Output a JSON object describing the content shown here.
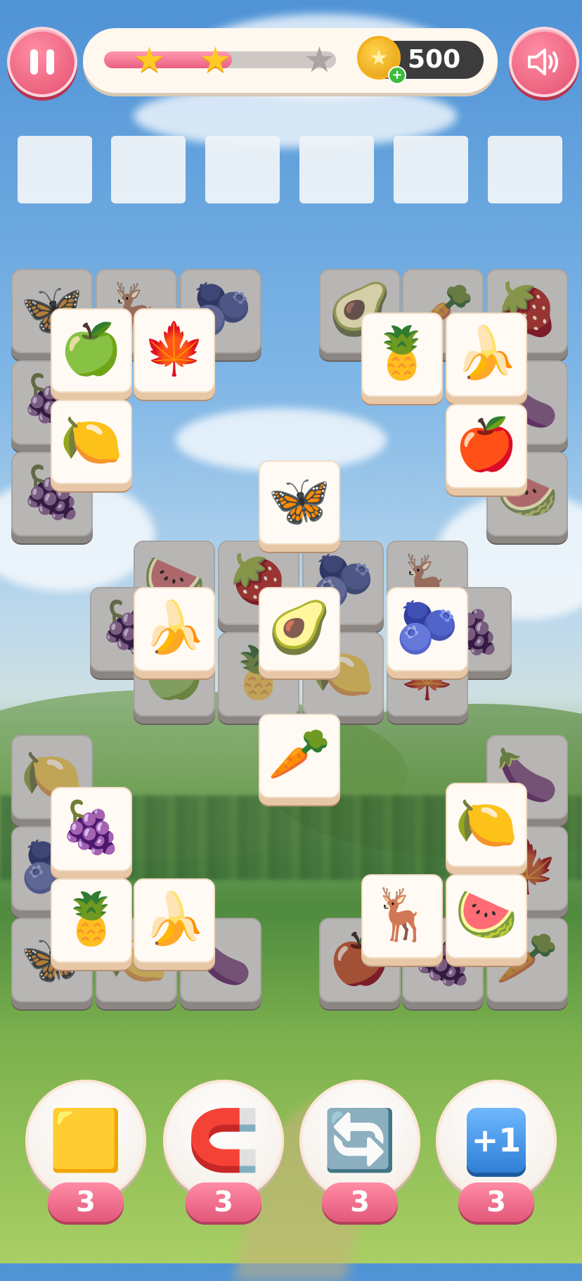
{
  "topbar": {
    "pause_icon": "pause-icon",
    "sound_icon": "speaker-icon",
    "progress_fraction": 0.55,
    "stars_earned": 2,
    "stars_total": 3,
    "coins": "500",
    "coin_icon": "coin-icon",
    "coin_add_icon": "plus-icon"
  },
  "tray": {
    "slot_count": 6,
    "slots_filled": 0
  },
  "tiles": {
    "back": [
      {
        "id": "b1",
        "icon": "🦋",
        "glyph": "🦋"
      },
      {
        "id": "b2",
        "icon": "🦌",
        "glyph": "🦌"
      },
      {
        "id": "b3",
        "icon": "🫐",
        "glyph": "🫐"
      },
      {
        "id": "b4",
        "icon": "🍇",
        "glyph": "🍇"
      },
      {
        "id": "b5",
        "icon": "🍇",
        "glyph": "🍇"
      },
      {
        "id": "b6",
        "icon": "🥑",
        "glyph": "🥑"
      },
      {
        "id": "b7",
        "icon": "🥕",
        "glyph": "🥕"
      },
      {
        "id": "b8",
        "icon": "🍓",
        "glyph": "🍓"
      },
      {
        "id": "b9",
        "icon": "🍆",
        "glyph": "🍆"
      },
      {
        "id": "b10",
        "icon": "🍉",
        "glyph": "🍉"
      },
      {
        "id": "b11",
        "icon": "🍉",
        "glyph": "🍉"
      },
      {
        "id": "b12",
        "icon": "🍓",
        "glyph": "🍓"
      },
      {
        "id": "b13",
        "icon": "🫐",
        "glyph": "🫐"
      },
      {
        "id": "b14",
        "icon": "🦌",
        "glyph": "🦌"
      },
      {
        "id": "b15",
        "icon": "🍇",
        "glyph": "🍇"
      },
      {
        "id": "b16",
        "icon": "🍇",
        "glyph": "🍇"
      },
      {
        "id": "b17",
        "icon": "🍏",
        "glyph": "🍏"
      },
      {
        "id": "b18",
        "icon": "🍍",
        "glyph": "🍍"
      },
      {
        "id": "b19",
        "icon": "🍋",
        "glyph": "🍋"
      },
      {
        "id": "b20",
        "icon": "🍁",
        "glyph": "🍁"
      },
      {
        "id": "b21",
        "icon": "🍋",
        "glyph": "🍋"
      },
      {
        "id": "b22",
        "icon": "🫐",
        "glyph": "🫐"
      },
      {
        "id": "b23",
        "icon": "🦋",
        "glyph": "🦋"
      },
      {
        "id": "b24",
        "icon": "🍋",
        "glyph": "🍋"
      },
      {
        "id": "b25",
        "icon": "🍆",
        "glyph": "🍆"
      },
      {
        "id": "b26",
        "icon": "🍆",
        "glyph": "🍆"
      },
      {
        "id": "b27",
        "icon": "🍁",
        "glyph": "🍁"
      },
      {
        "id": "b28",
        "icon": "🍎",
        "glyph": "🍎"
      },
      {
        "id": "b29",
        "icon": "🍇",
        "glyph": "🍇"
      },
      {
        "id": "b30",
        "icon": "🥕",
        "glyph": "🥕"
      }
    ],
    "front": [
      {
        "id": "f1",
        "icon": "🍏",
        "glyph": "🍏"
      },
      {
        "id": "f2",
        "icon": "🍁",
        "glyph": "🍁"
      },
      {
        "id": "f3",
        "icon": "🍋",
        "glyph": "🍋"
      },
      {
        "id": "f4",
        "icon": "🍍",
        "glyph": "🍍"
      },
      {
        "id": "f5",
        "icon": "🍌",
        "glyph": "🍌"
      },
      {
        "id": "f6",
        "icon": "🍎",
        "glyph": "🍎"
      },
      {
        "id": "f7",
        "icon": "🦋",
        "glyph": "🦋"
      },
      {
        "id": "f8",
        "icon": "🍌",
        "glyph": "🍌"
      },
      {
        "id": "f9",
        "icon": "🥑",
        "glyph": "🥑"
      },
      {
        "id": "f10",
        "icon": "🫐",
        "glyph": "🫐"
      },
      {
        "id": "f11",
        "icon": "🥕",
        "glyph": "🥕"
      },
      {
        "id": "f12",
        "icon": "🍇",
        "glyph": "🍇"
      },
      {
        "id": "f13",
        "icon": "🍋",
        "glyph": "🍋"
      },
      {
        "id": "f14",
        "icon": "🍍",
        "glyph": "🍍"
      },
      {
        "id": "f15",
        "icon": "🍌",
        "glyph": "🍌"
      },
      {
        "id": "f16",
        "icon": "🦌",
        "glyph": "🦌"
      },
      {
        "id": "f17",
        "icon": "🍉",
        "glyph": "🍉"
      }
    ]
  },
  "boosters": [
    {
      "name": "shuffle-tiles",
      "icon": "tiles-icon",
      "glyph": "🟨",
      "count": "3"
    },
    {
      "name": "magnet",
      "icon": "magnet-icon",
      "glyph": "🧲",
      "count": "3"
    },
    {
      "name": "refresh",
      "icon": "refresh-icon",
      "glyph": "🔄",
      "count": "3"
    },
    {
      "name": "extra-slot",
      "icon": "plus-one-icon",
      "glyph": "+1",
      "count": "3"
    }
  ]
}
